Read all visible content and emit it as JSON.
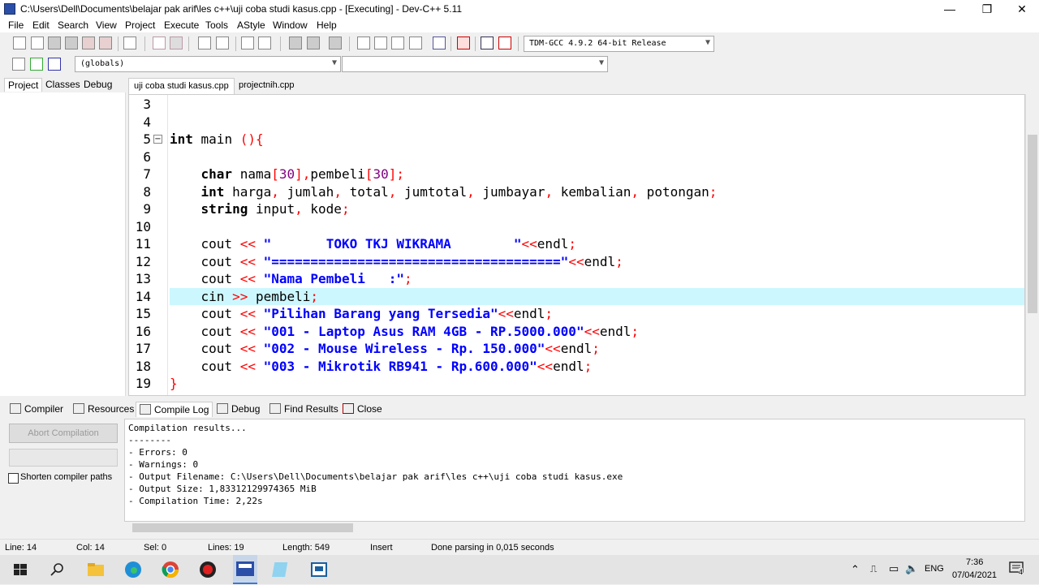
{
  "window": {
    "title": "C:\\Users\\Dell\\Documents\\belajar pak arif\\les c++\\uji coba studi kasus.cpp - [Executing] - Dev-C++ 5.11",
    "minimize": "—",
    "restore": "❐",
    "close": "✕"
  },
  "menu": [
    "File",
    "Edit",
    "Search",
    "View",
    "Project",
    "Execute",
    "Tools",
    "AStyle",
    "Window",
    "Help"
  ],
  "toolbar": {
    "compiler_select": "TDM-GCC 4.9.2 64-bit Release",
    "scope_select": "(globals)",
    "symbol_select": ""
  },
  "left_tabs": [
    "Project",
    "Classes",
    "Debug"
  ],
  "file_tabs": [
    "uji coba studi kasus.cpp",
    "projectnih.cpp"
  ],
  "editor": {
    "active_line": 14,
    "lines": [
      {
        "n": "3",
        "code": ""
      },
      {
        "n": "4",
        "code": ""
      },
      {
        "n": "5",
        "code": "int main (){"
      },
      {
        "n": "6",
        "code": ""
      },
      {
        "n": "7",
        "code": "    char nama[30],pembeli[30];"
      },
      {
        "n": "8",
        "code": "    int harga, jumlah, total, jumtotal, jumbayar, kembalian, potongan;"
      },
      {
        "n": "9",
        "code": "    string input, kode;"
      },
      {
        "n": "10",
        "code": ""
      },
      {
        "n": "11",
        "code": "    cout << \"       TOKO TKJ WIKRAMA        \"<<endl;"
      },
      {
        "n": "12",
        "code": "    cout << \"=====================================\"<<endl;"
      },
      {
        "n": "13",
        "code": "    cout << \"Nama Pembeli   :\";"
      },
      {
        "n": "14",
        "code": "    cin >> pembeli;"
      },
      {
        "n": "15",
        "code": "    cout << \"Pilihan Barang yang Tersedia\"<<endl;"
      },
      {
        "n": "16",
        "code": "    cout << \"001 - Laptop Asus RAM 4GB - RP.5000.000\"<<endl;"
      },
      {
        "n": "17",
        "code": "    cout << \"002 - Mouse Wireless - Rp. 150.000\"<<endl;"
      },
      {
        "n": "18",
        "code": "    cout << \"003 - Mikrotik RB941 - Rp.600.000\"<<endl;"
      },
      {
        "n": "19",
        "code": "}"
      }
    ]
  },
  "bottom_tabs": [
    "Compiler",
    "Resources",
    "Compile Log",
    "Debug",
    "Find Results",
    "Close"
  ],
  "bottom_left": {
    "abort_label": "Abort Compilation",
    "shorten_label": "Shorten compiler paths"
  },
  "compile_log": [
    "Compilation results...",
    "--------",
    "- Errors: 0",
    "- Warnings: 0",
    "- Output Filename: C:\\Users\\Dell\\Documents\\belajar pak arif\\les c++\\uji coba studi kasus.exe",
    "- Output Size: 1,83312129974365 MiB",
    "- Compilation Time: 2,22s"
  ],
  "status": {
    "line": "Line:  14",
    "col": "Col:  14",
    "sel": "Sel:  0",
    "lines": "Lines:  19",
    "length": "Length:  549",
    "mode": "Insert",
    "message": "Done parsing in 0,015 seconds"
  },
  "taskbar": {
    "time": "7:36",
    "date": "07/04/2021",
    "lang": "ENG",
    "notif_count": "4"
  },
  "colors": {
    "keyword": "#000000",
    "string": "#0000ff",
    "operator": "#ff0000",
    "number": "#800080",
    "active_line": "#ccf7ff"
  }
}
